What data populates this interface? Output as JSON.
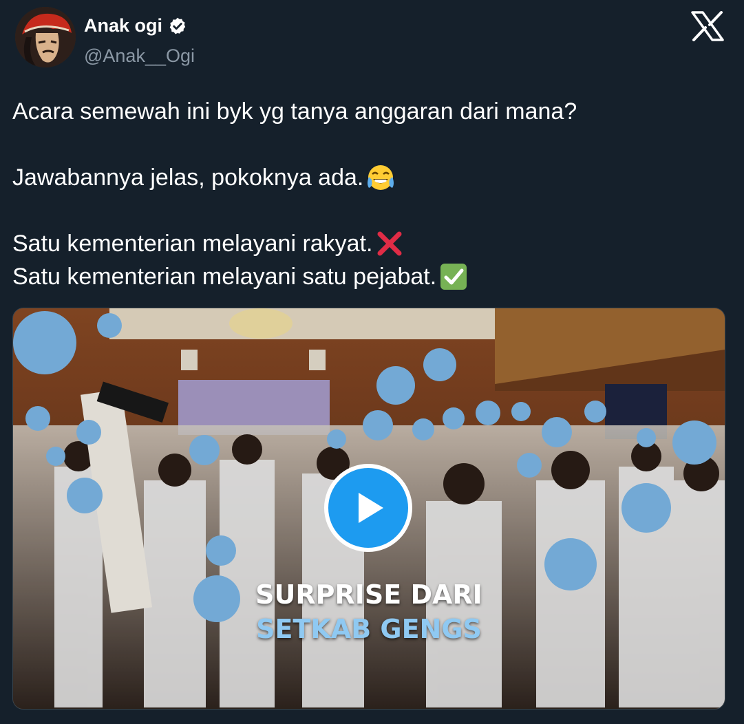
{
  "author": {
    "display_name": "Anak ogi",
    "handle": "@Anak__Ogi",
    "verified": true,
    "avatar_icon": "warrior-avatar-icon"
  },
  "brand": {
    "logo_icon": "x-logo-icon",
    "color": "#ffffff"
  },
  "tweet": {
    "lines": [
      "Acara semewah ini byk yg tanya anggaran dari mana?",
      "",
      "Jawabannya jelas, pokoknya ada.",
      "",
      "Satu kementerian melayani rakyat.",
      "Satu kementerian melayani satu pejabat."
    ],
    "emojis": [
      "tears-of-joy-emoji",
      "cross-mark-emoji",
      "check-mark-emoji"
    ]
  },
  "media": {
    "type": "video",
    "overlay_line1": "SURPRISE DARI",
    "overlay_line2": "SETKAB GENGS",
    "play_icon": "play-icon",
    "accent": "#1d9bf0"
  },
  "colors": {
    "background": "#15202b",
    "text": "#ffffff",
    "muted": "#8b98a5",
    "verified": "#ffffff"
  }
}
